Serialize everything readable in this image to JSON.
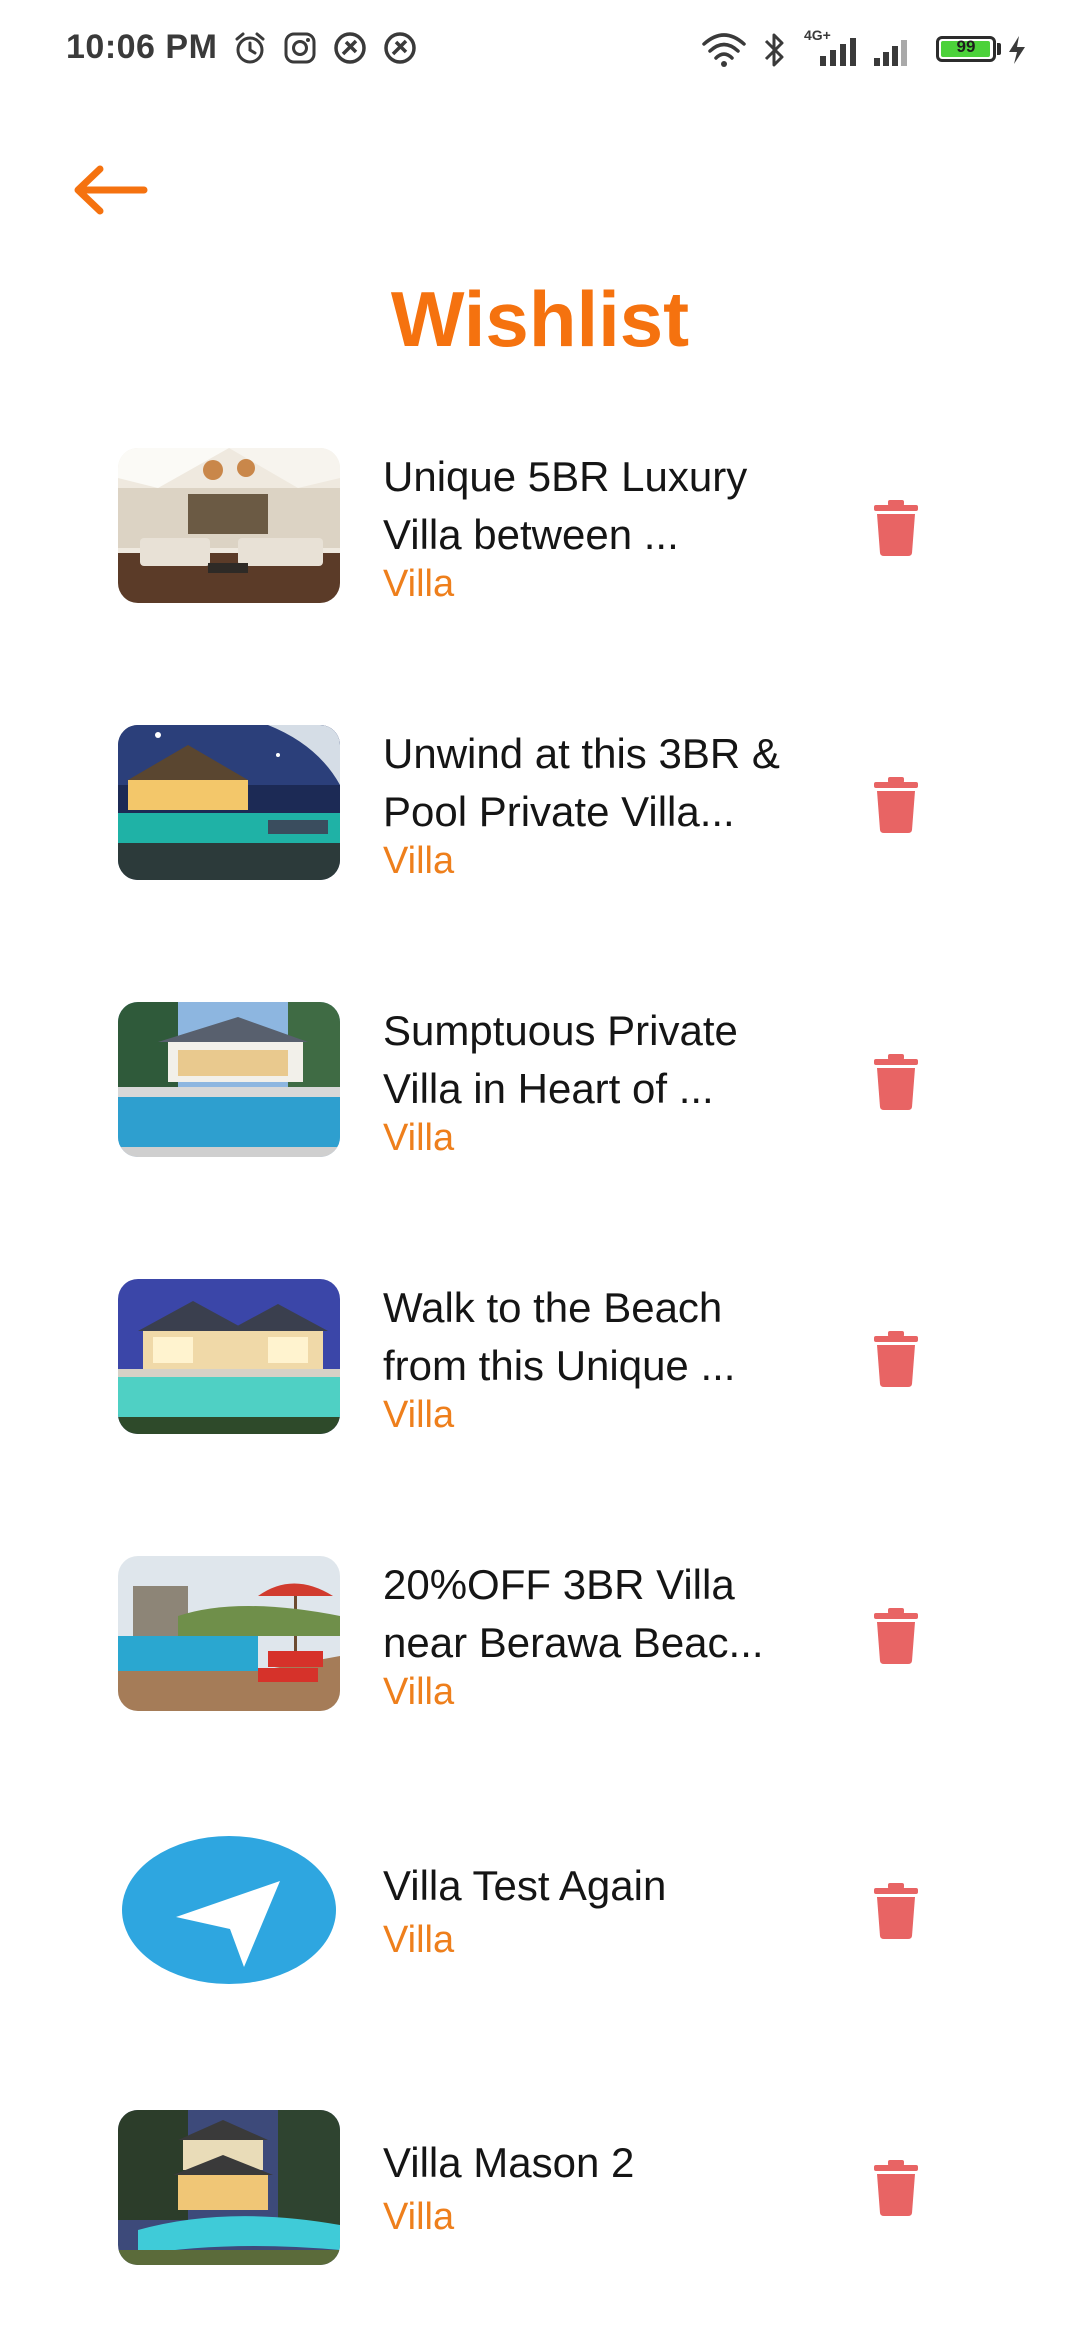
{
  "status_bar": {
    "time": "10:06 PM",
    "network_label": "4G+",
    "battery_level": 99,
    "battery_text": "99"
  },
  "header": {
    "back_icon": "arrow-left-icon",
    "title": "Wishlist"
  },
  "colors": {
    "accent": "#f5720f",
    "category": "#ee7f1c",
    "delete": "#e86464",
    "telegram_blue": "#2ea6e0"
  },
  "wishlist": [
    {
      "title": "Unique 5BR Luxury Villa between ...",
      "category": "Villa"
    },
    {
      "title": "Unwind at this 3BR & Pool Private Villa...",
      "category": "Villa"
    },
    {
      "title": "Sumptuous Private Villa in Heart of ...",
      "category": "Villa"
    },
    {
      "title": "Walk to the Beach from this Unique ...",
      "category": "Villa"
    },
    {
      "title": "20%OFF 3BR Villa near Berawa Beac...",
      "category": "Villa"
    },
    {
      "title": "Villa Test Again",
      "category": "Villa"
    },
    {
      "title": "Villa Mason 2",
      "category": "Villa"
    }
  ]
}
